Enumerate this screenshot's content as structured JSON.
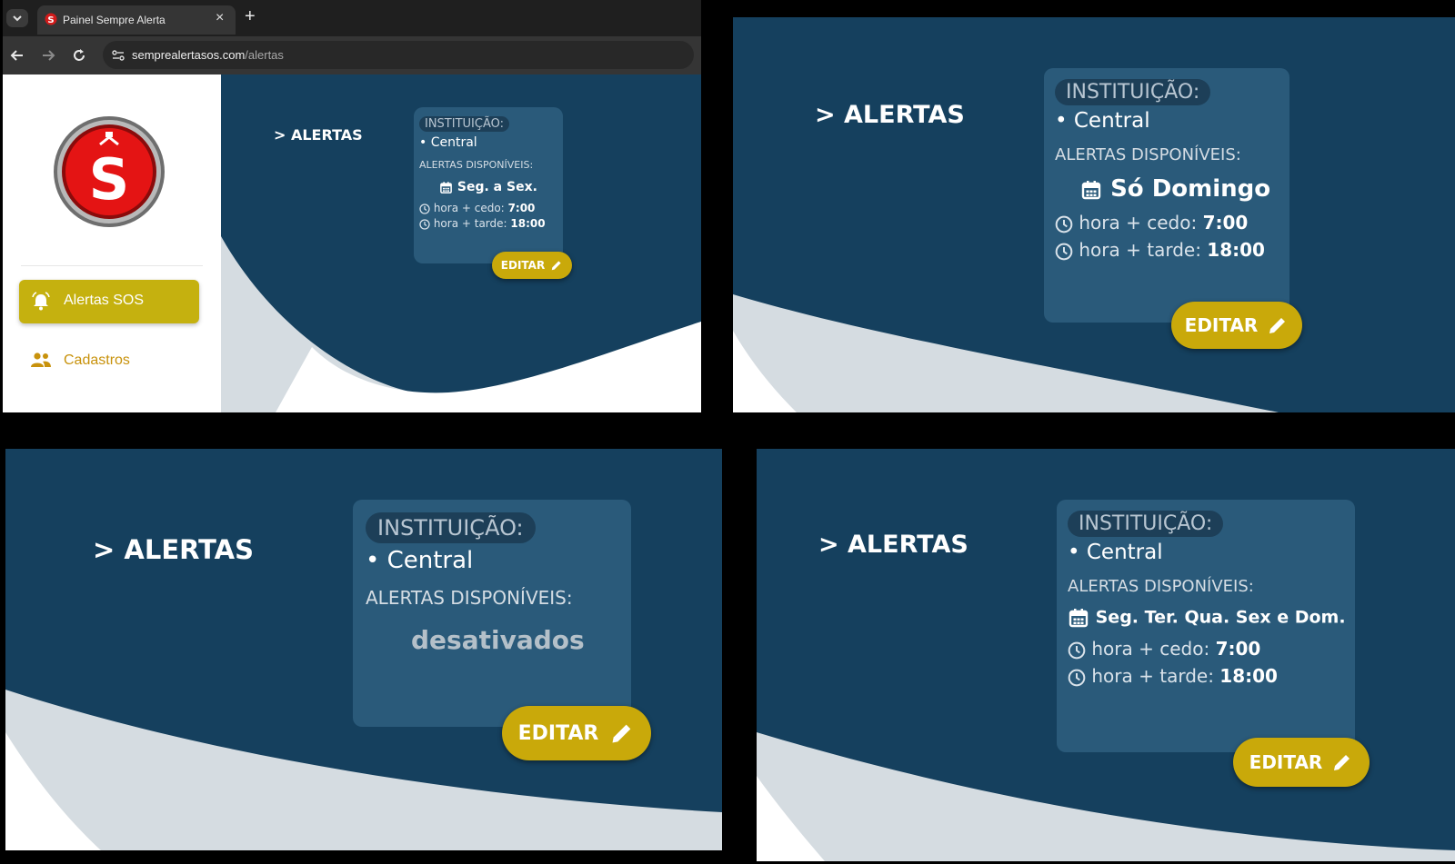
{
  "browser": {
    "tab_title": "Painel Sempre Alerta",
    "new_tab_symbol": "+",
    "close_tab_symbol": "×",
    "url_domain": "semprealertasos.com",
    "url_path": "/alertas"
  },
  "sidebar": {
    "logo_icon": "sempre-alerta-logo-icon",
    "items": [
      {
        "label": "Alertas SOS",
        "icon": "bell-icon",
        "active": true
      },
      {
        "label": "Cadastros",
        "icon": "people-icon",
        "active": false
      }
    ]
  },
  "panels": [
    {
      "title": "> ALERTAS",
      "institution_label": "INSTITUIÇÃO:",
      "institution": "• Central",
      "available_label": "ALERTAS DISPONÍVEIS:",
      "days": "Seg. a Sex.",
      "early_label": "hora + cedo:",
      "early_time": "7:00",
      "late_label": "hora + tarde:",
      "late_time": "18:00",
      "edit_label": "EDITAR"
    },
    {
      "title": "> ALERTAS",
      "institution_label": "INSTITUIÇÃO:",
      "institution": "• Central",
      "available_label": "ALERTAS DISPONÍVEIS:",
      "days": "Só Domingo",
      "early_label": "hora + cedo:",
      "early_time": "7:00",
      "late_label": "hora + tarde:",
      "late_time": "18:00",
      "edit_label": "EDITAR"
    },
    {
      "title": "> ALERTAS",
      "institution_label": "INSTITUIÇÃO:",
      "institution": "• Central",
      "available_label": "ALERTAS DISPONÍVEIS:",
      "disabled_text": "desativados",
      "edit_label": "EDITAR"
    },
    {
      "title": "> ALERTAS",
      "institution_label": "INSTITUIÇÃO:",
      "institution": "• Central",
      "available_label": "ALERTAS DISPONÍVEIS:",
      "days": "Seg. Ter. Qua. Sex e Dom.",
      "early_label": "hora + cedo:",
      "early_time": "7:00",
      "late_label": "hora + tarde:",
      "late_time": "18:00",
      "edit_label": "EDITAR"
    }
  ],
  "colors": {
    "navy_background": "#15405e",
    "card": "#2a5a7a",
    "button_gold": "#c9a90a",
    "wave_grey": "#d5dce1",
    "sidebar_white": "#ffffff",
    "cadastros_text": "#c8920c"
  }
}
